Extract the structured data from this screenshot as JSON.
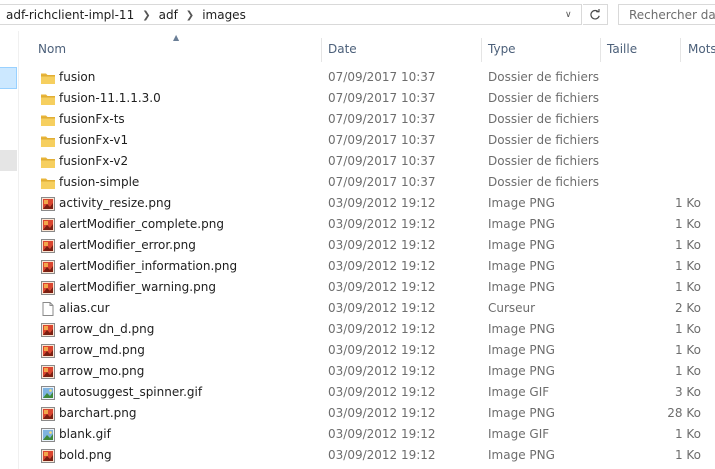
{
  "address_bar": {
    "crumbs": [
      "adf-richclient-impl-11",
      "adf",
      "images"
    ]
  },
  "search": {
    "placeholder": "Rechercher dans"
  },
  "columns": {
    "name": "Nom",
    "date": "Date",
    "type": "Type",
    "size": "Taille",
    "tags": "Mots"
  },
  "files": [
    {
      "name": "fusion",
      "date": "07/09/2017 10:37",
      "type": "Dossier de fichiers",
      "size": "",
      "icon": "folder-icon"
    },
    {
      "name": "fusion-11.1.1.3.0",
      "date": "07/09/2017 10:37",
      "type": "Dossier de fichiers",
      "size": "",
      "icon": "folder-icon"
    },
    {
      "name": "fusionFx-ts",
      "date": "07/09/2017 10:37",
      "type": "Dossier de fichiers",
      "size": "",
      "icon": "folder-icon"
    },
    {
      "name": "fusionFx-v1",
      "date": "07/09/2017 10:37",
      "type": "Dossier de fichiers",
      "size": "",
      "icon": "folder-icon"
    },
    {
      "name": "fusionFx-v2",
      "date": "07/09/2017 10:37",
      "type": "Dossier de fichiers",
      "size": "",
      "icon": "folder-icon"
    },
    {
      "name": "fusion-simple",
      "date": "07/09/2017 10:37",
      "type": "Dossier de fichiers",
      "size": "",
      "icon": "folder-icon"
    },
    {
      "name": "activity_resize.png",
      "date": "03/09/2012 19:12",
      "type": "Image PNG",
      "size": "1 Ko",
      "icon": "png-file-icon"
    },
    {
      "name": "alertModifier_complete.png",
      "date": "03/09/2012 19:12",
      "type": "Image PNG",
      "size": "1 Ko",
      "icon": "png-file-icon"
    },
    {
      "name": "alertModifier_error.png",
      "date": "03/09/2012 19:12",
      "type": "Image PNG",
      "size": "1 Ko",
      "icon": "png-file-icon"
    },
    {
      "name": "alertModifier_information.png",
      "date": "03/09/2012 19:12",
      "type": "Image PNG",
      "size": "1 Ko",
      "icon": "png-file-icon"
    },
    {
      "name": "alertModifier_warning.png",
      "date": "03/09/2012 19:12",
      "type": "Image PNG",
      "size": "1 Ko",
      "icon": "png-file-icon"
    },
    {
      "name": "alias.cur",
      "date": "03/09/2012 19:12",
      "type": "Curseur",
      "size": "2 Ko",
      "icon": "blank-file-icon"
    },
    {
      "name": "arrow_dn_d.png",
      "date": "03/09/2012 19:12",
      "type": "Image PNG",
      "size": "1 Ko",
      "icon": "png-file-icon"
    },
    {
      "name": "arrow_md.png",
      "date": "03/09/2012 19:12",
      "type": "Image PNG",
      "size": "1 Ko",
      "icon": "png-file-icon"
    },
    {
      "name": "arrow_mo.png",
      "date": "03/09/2012 19:12",
      "type": "Image PNG",
      "size": "1 Ko",
      "icon": "png-file-icon"
    },
    {
      "name": "autosuggest_spinner.gif",
      "date": "03/09/2012 19:12",
      "type": "Image GIF",
      "size": "3 Ko",
      "icon": "gif-file-icon"
    },
    {
      "name": "barchart.png",
      "date": "03/09/2012 19:12",
      "type": "Image PNG",
      "size": "28 Ko",
      "icon": "png-file-icon"
    },
    {
      "name": "blank.gif",
      "date": "03/09/2012 19:12",
      "type": "Image GIF",
      "size": "1 Ko",
      "icon": "gif-file-icon"
    },
    {
      "name": "bold.png",
      "date": "03/09/2012 19:12",
      "type": "Image PNG",
      "size": "1 Ko",
      "icon": "png-file-icon"
    }
  ]
}
